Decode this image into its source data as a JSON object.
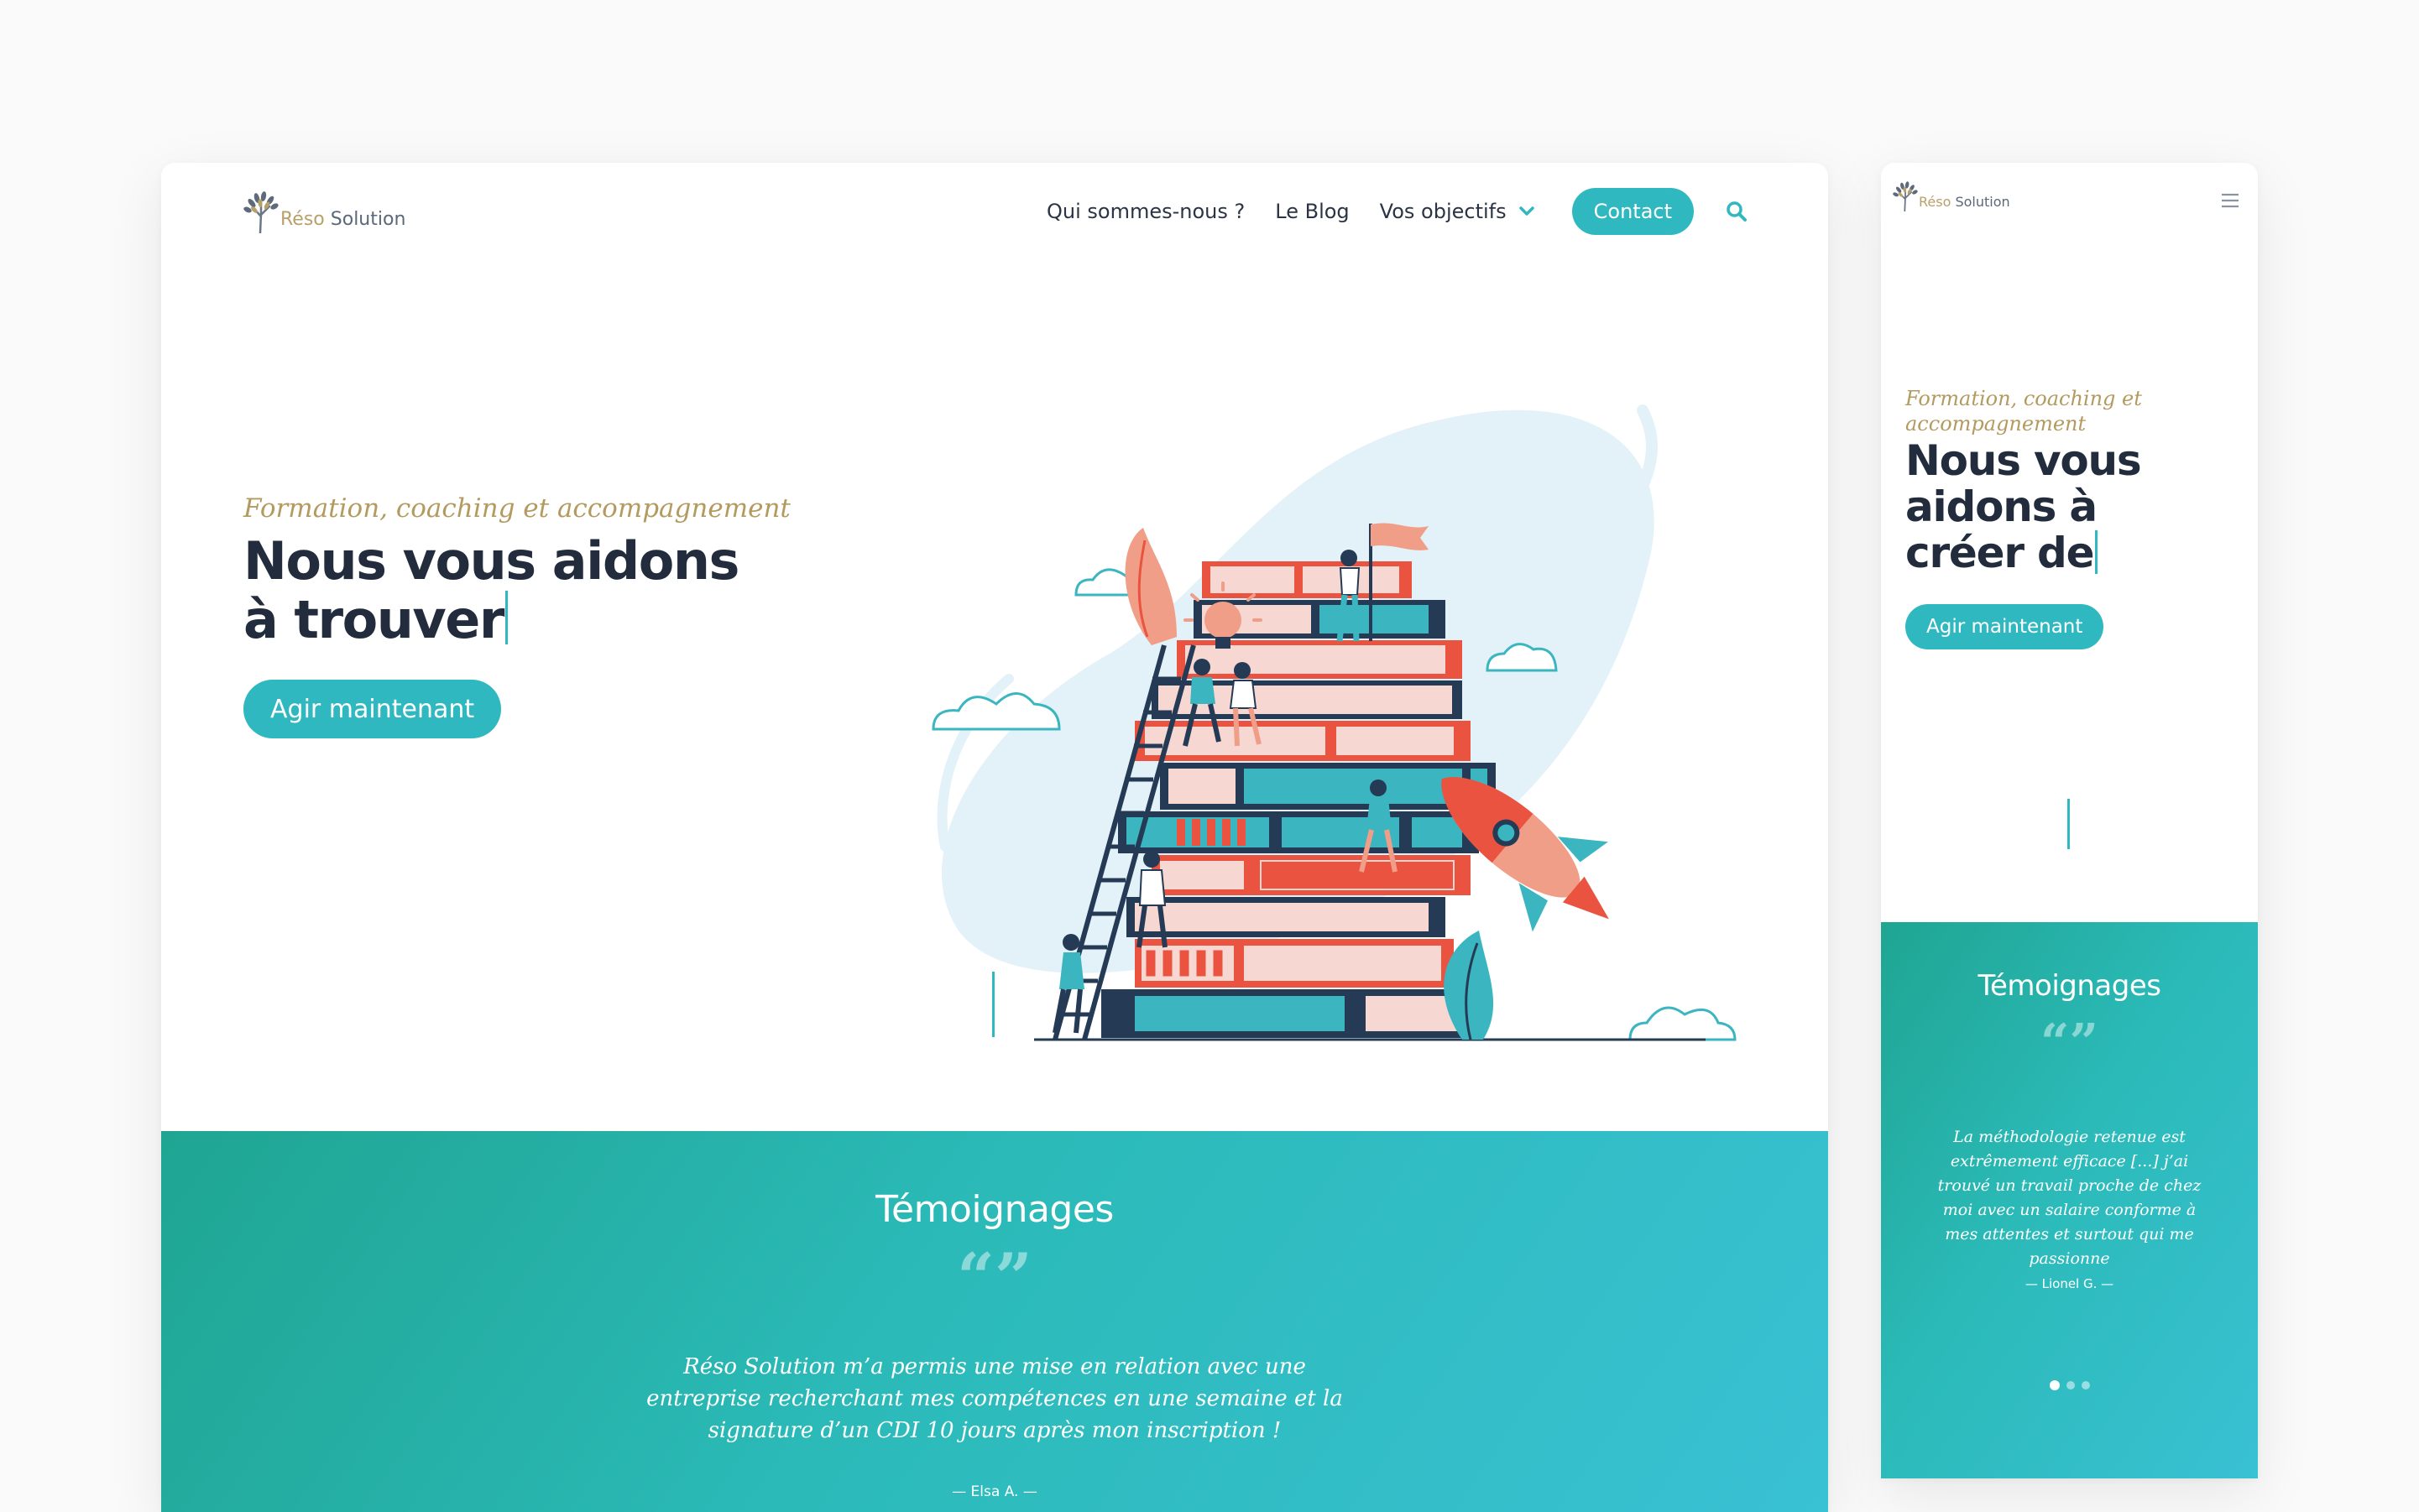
{
  "colors": {
    "accent": "#2fb8c0",
    "gold": "#b39a5e",
    "ink": "#222c3c",
    "gradient_start": "#1fa592",
    "gradient_end": "#39c1d4"
  },
  "brand": {
    "name_part1": "Réso",
    "name_part2": "Solution"
  },
  "desktop": {
    "nav": {
      "items": [
        {
          "label": "Qui sommes-nous ?"
        },
        {
          "label": "Le Blog"
        },
        {
          "label": "Vos objectifs",
          "icon": "chevron-down-icon"
        }
      ],
      "contact_label": "Contact",
      "search_icon": "search-icon"
    },
    "hero": {
      "tagline": "Formation, coaching et accompagnement",
      "heading": "Nous vous aidons à trouver",
      "cta_label": "Agir maintenant",
      "illustration": "books-stack-illustration"
    },
    "testimonials": {
      "title": "Témoignages",
      "quote_mark": "“”",
      "quote": "Réso Solution m’a permis une mise en relation avec une entreprise recherchant mes compétences en une semaine et la signature d’un CDI 10 jours après mon inscription !",
      "author": "— Elsa A. —"
    }
  },
  "mobile": {
    "menu_icon": "hamburger-icon",
    "hero": {
      "tagline": "Formation, coaching et accompagnement",
      "heading": "Nous vous aidons à créer de",
      "cta_label": "Agir maintenant"
    },
    "testimonials": {
      "title": "Témoignages",
      "quote_mark": "“”",
      "quote": "La méthodologie retenue est extrêmement efficace [...] j’ai trouvé un travail proche de chez moi avec un salaire conforme à mes attentes et surtout qui me passionne",
      "author": "— Lionel G. —",
      "carousel_total": 3,
      "carousel_active": 1
    }
  }
}
